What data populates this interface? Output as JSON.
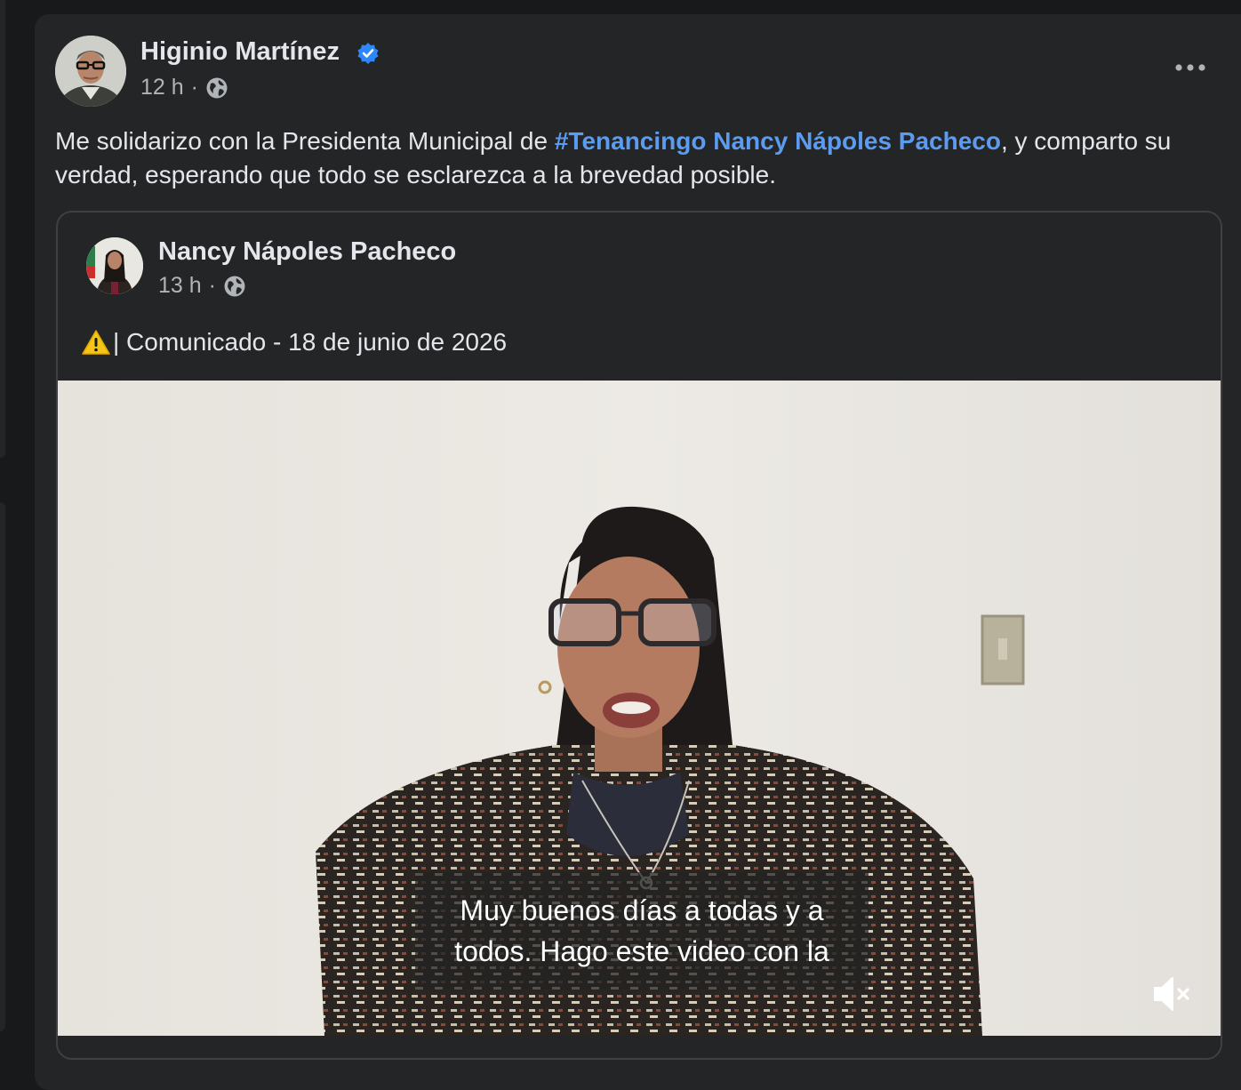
{
  "post": {
    "author": "Higinio Martínez",
    "time": "12 h",
    "separator": "·",
    "text_before": "Me solidarizo con la Presidenta Municipal de ",
    "hashtag": "#Tenancingo",
    "mention": "Nancy Nápoles Pacheco",
    "text_after": ", y comparto su verdad, esperando que todo se esclarezca a la brevedad posible.",
    "more_icon": "more-horizontal-icon"
  },
  "shared": {
    "author": "Nancy Nápoles Pacheco",
    "time": "13 h",
    "separator": "·",
    "text": "| Comunicado - 18 de junio de 2026",
    "warning_icon": "warning-icon"
  },
  "video": {
    "caption_line1": "Muy buenos días a todas y a",
    "caption_line2": "todos. Hago este video con la",
    "mute_icon": "muted-volume-icon"
  },
  "colors": {
    "background": "#18191a",
    "card": "#242526",
    "link": "#5b9bf0",
    "verified": "#2d88ff",
    "secondary_text": "#b0b3b8"
  }
}
